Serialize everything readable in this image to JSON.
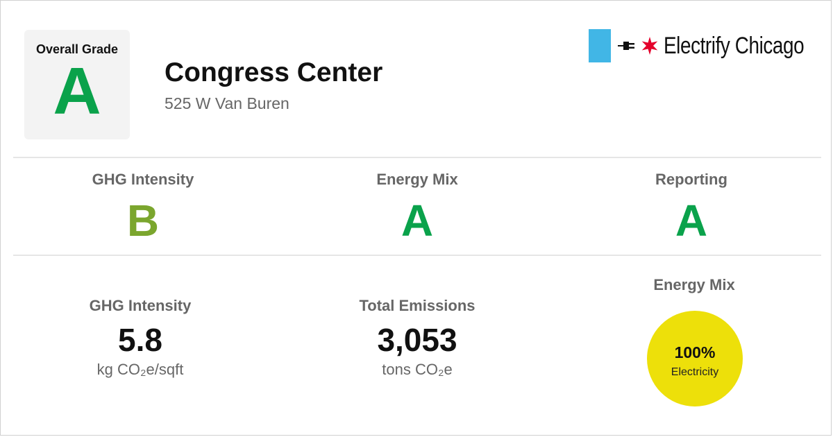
{
  "overall": {
    "label": "Overall Grade",
    "grade": "A"
  },
  "building": {
    "name": "Congress Center",
    "address": "525 W Van Buren"
  },
  "logo": {
    "text": "Electrify Chicago"
  },
  "grades": [
    {
      "label": "GHG Intensity",
      "grade": "B",
      "color": "#7ba62e"
    },
    {
      "label": "Energy Mix",
      "grade": "A",
      "color": "#0aa24b"
    },
    {
      "label": "Reporting",
      "grade": "A",
      "color": "#0aa24b"
    }
  ],
  "metrics": {
    "ghg": {
      "label": "GHG Intensity",
      "value": "5.8",
      "unit": "kg CO₂e/sqft"
    },
    "emissions": {
      "label": "Total Emissions",
      "value": "3,053",
      "unit": "tons CO₂e"
    },
    "energy_mix": {
      "label": "Energy Mix",
      "percent": "100%",
      "source": "Electricity",
      "fraction": 1.0
    }
  },
  "colors": {
    "grade_a": "#0aa24b",
    "grade_b": "#7ba62e",
    "logo_blue": "#41b6e6",
    "logo_red": "#e4002b",
    "electricity": "#ede00a"
  }
}
